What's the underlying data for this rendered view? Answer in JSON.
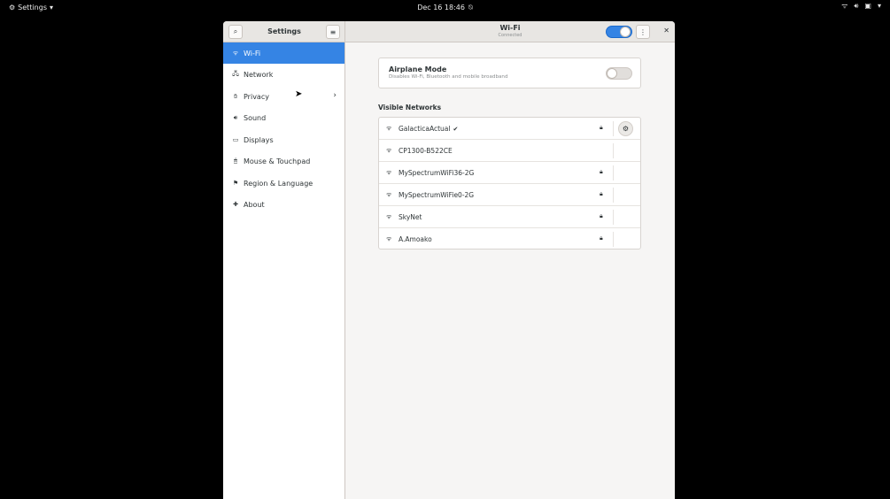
{
  "topbar": {
    "app_menu_icon": "gear-icon",
    "app_menu_label": "Settings",
    "app_menu_arrow": "▾",
    "clock": "Dec 16  18:46",
    "dnd_icon": "notifications-off-icon",
    "tray_icons": [
      "wifi-icon",
      "volume-icon",
      "battery-icon",
      "menu-arrow-icon"
    ]
  },
  "header": {
    "sidebar_title": "Settings",
    "panel_title": "Wi-Fi",
    "panel_subtitle": "Connected",
    "wifi_enabled": true
  },
  "sidebar": {
    "items": [
      {
        "icon": "wifi-icon",
        "label": "Wi-Fi",
        "active": true
      },
      {
        "icon": "network-icon",
        "label": "Network",
        "active": false
      },
      {
        "icon": "privacy-hand-icon",
        "label": "Privacy",
        "active": false,
        "has_chevron": true
      },
      {
        "icon": "speaker-icon",
        "label": "Sound",
        "active": false
      },
      {
        "icon": "display-icon",
        "label": "Displays",
        "active": false
      },
      {
        "icon": "mouse-icon",
        "label": "Mouse & Touchpad",
        "active": false
      },
      {
        "icon": "flag-icon",
        "label": "Region & Language",
        "active": false
      },
      {
        "icon": "plus-star-icon",
        "label": "About",
        "active": false
      }
    ]
  },
  "airplane": {
    "title": "Airplane Mode",
    "description": "Disables Wi-Fi, Bluetooth and mobile broadband",
    "enabled": false
  },
  "networks": {
    "section_title": "Visible Networks",
    "items": [
      {
        "name": "GalacticaActual",
        "connected": true,
        "secured": true
      },
      {
        "name": "CP1300-B522CE",
        "connected": false,
        "secured": false
      },
      {
        "name": "MySpectrumWiFi36-2G",
        "connected": false,
        "secured": true
      },
      {
        "name": "MySpectrumWiFie0-2G",
        "connected": false,
        "secured": true
      },
      {
        "name": "SkyNet",
        "connected": false,
        "secured": true
      },
      {
        "name": "A.Amoako",
        "connected": false,
        "secured": true
      }
    ]
  },
  "colors": {
    "accent": "#3584e4",
    "window_bg": "#f6f5f4",
    "text": "#2e3436"
  }
}
